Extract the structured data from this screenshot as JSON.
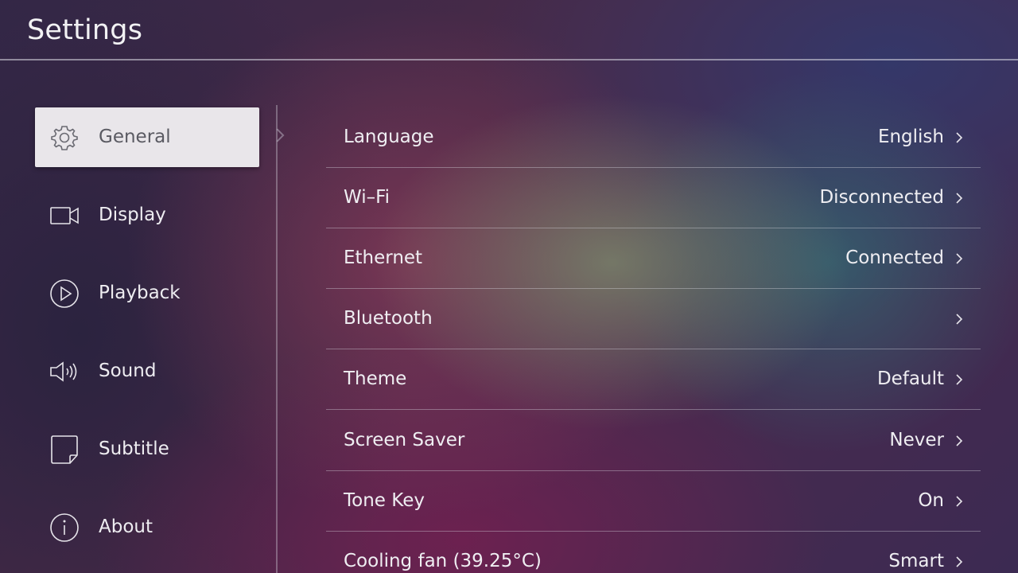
{
  "header": {
    "title": "Settings"
  },
  "sidebar": {
    "items": [
      {
        "label": "General",
        "icon": "gear-icon",
        "active": true
      },
      {
        "label": "Display",
        "icon": "display-icon",
        "active": false
      },
      {
        "label": "Playback",
        "icon": "play-circle-icon",
        "active": false
      },
      {
        "label": "Sound",
        "icon": "speaker-icon",
        "active": false
      },
      {
        "label": "Subtitle",
        "icon": "subtitle-icon",
        "active": false
      },
      {
        "label": "About",
        "icon": "info-icon",
        "active": false
      }
    ]
  },
  "settings": {
    "rows": [
      {
        "label": "Language",
        "value": "English"
      },
      {
        "label": "Wi–Fi",
        "value": "Disconnected"
      },
      {
        "label": "Ethernet",
        "value": "Connected"
      },
      {
        "label": "Bluetooth",
        "value": ""
      },
      {
        "label": "Theme",
        "value": "Default"
      },
      {
        "label": "Screen Saver",
        "value": "Never"
      },
      {
        "label": "Tone Key",
        "value": "On"
      },
      {
        "label": "Cooling fan (39.25°C)",
        "value": "Smart"
      }
    ],
    "chevron_icon": "chevron-right-icon"
  },
  "colors": {
    "active_item_bg": "#e9e6ea",
    "active_item_text": "#5a5a62",
    "text": "#efeef2"
  }
}
